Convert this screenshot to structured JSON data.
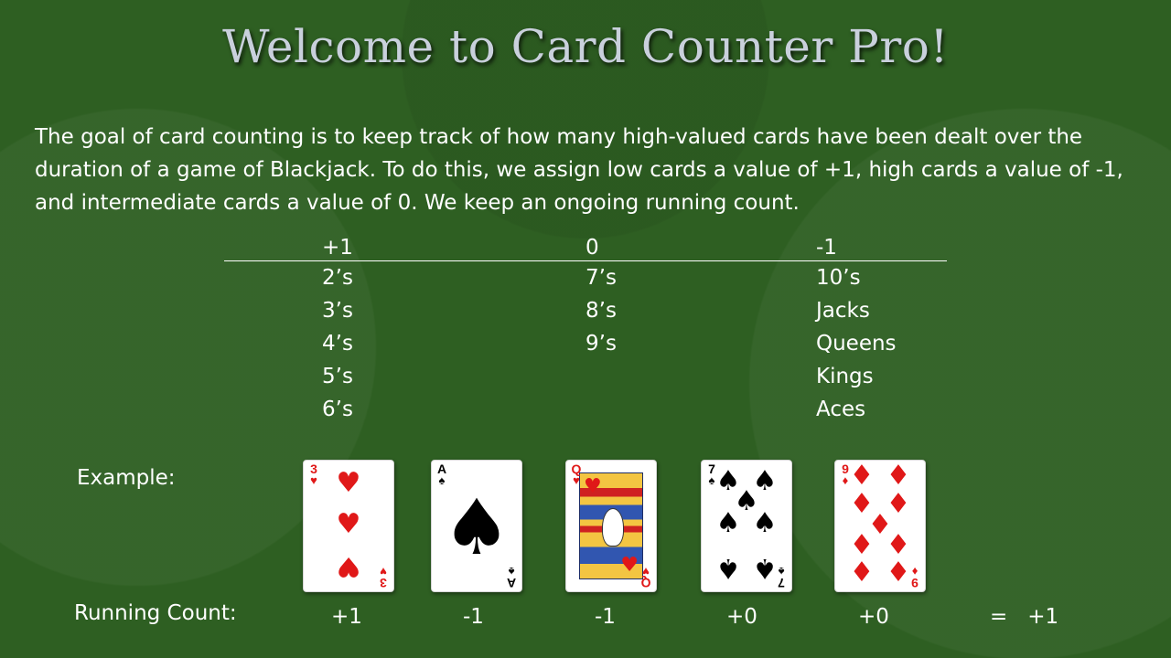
{
  "title": "Welcome to Card Counter Pro!",
  "intro": "The goal of card counting is to keep track of how many high-valued cards have been dealt over the duration of a game of Blackjack. To do this, we assign low cards a value of +1, high cards a value of -1, and intermediate cards a value of 0. We keep an ongoing running count.",
  "table": {
    "headers": [
      "+1",
      "0",
      "-1"
    ],
    "columns": [
      [
        "2’s",
        "3’s",
        "4’s",
        "5’s",
        "6’s"
      ],
      [
        "7’s",
        "8’s",
        "9’s"
      ],
      [
        "10’s",
        "Jacks",
        "Queens",
        "Kings",
        "Aces"
      ]
    ]
  },
  "example_label": "Example:",
  "cards": [
    {
      "rank": "3",
      "suit": "♥",
      "color": "#e01818"
    },
    {
      "rank": "A",
      "suit": "♠",
      "color": "#000000"
    },
    {
      "rank": "Q",
      "suit": "♥",
      "color": "#e01818"
    },
    {
      "rank": "7",
      "suit": "♠",
      "color": "#000000"
    },
    {
      "rank": "9",
      "suit": "♦",
      "color": "#e01818"
    }
  ],
  "running_count": {
    "label": "Running Count:",
    "values": [
      "+1",
      "-1",
      "-1",
      "+0",
      "+0"
    ],
    "total": "=   +1"
  },
  "colors": {
    "background": "#2e5f22",
    "title": "#c9d0dc",
    "text": "#ffffff"
  }
}
